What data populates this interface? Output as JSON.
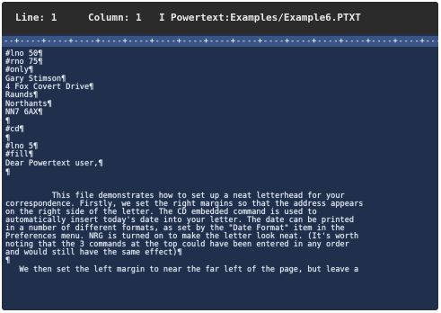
{
  "status_bar": {
    "line": "Line: 1",
    "column": "Column: 1",
    "insert_indicator": "I",
    "file_path": "Powertext:Examples/Example6.PTXT"
  },
  "ruler": {
    "text": "--+----+----+----+----+----+----+----+----+----+----+----+----+----+----+----+----+----+----+----+-->"
  },
  "document": {
    "lines": [
      "#lno 50¶",
      "#rno 75¶",
      "#only¶",
      "Gary Stimson¶",
      "4 Fox Covert Drive¶",
      "Raunds¶",
      "Northants¶",
      "NN7 6AX¶",
      "¶",
      "#cd¶",
      "¶",
      "#lno 5¶",
      "#fill¶",
      "Dear Powertext user,¶",
      "¶",
      "          This file demonstrates how to set up a neat letterhead for your",
      "correspondence. Firstly, we set the right margins so that the address appears",
      "on the right side of the letter. The CD embedded command is used to",
      "automatically insert today's date into your letter. The date can be printed",
      "in a number of different formats, as set by the \"Date Format\" item in the",
      "Preferences menu. NRG is turned on to make the letter look neat. (It's worth",
      "noting that the 3 commands at the top could have been entered in any order",
      "and would still have the same effect)¶",
      "¶",
      "   We then set the left margin to near the far left of the page, but leave a"
    ]
  }
}
